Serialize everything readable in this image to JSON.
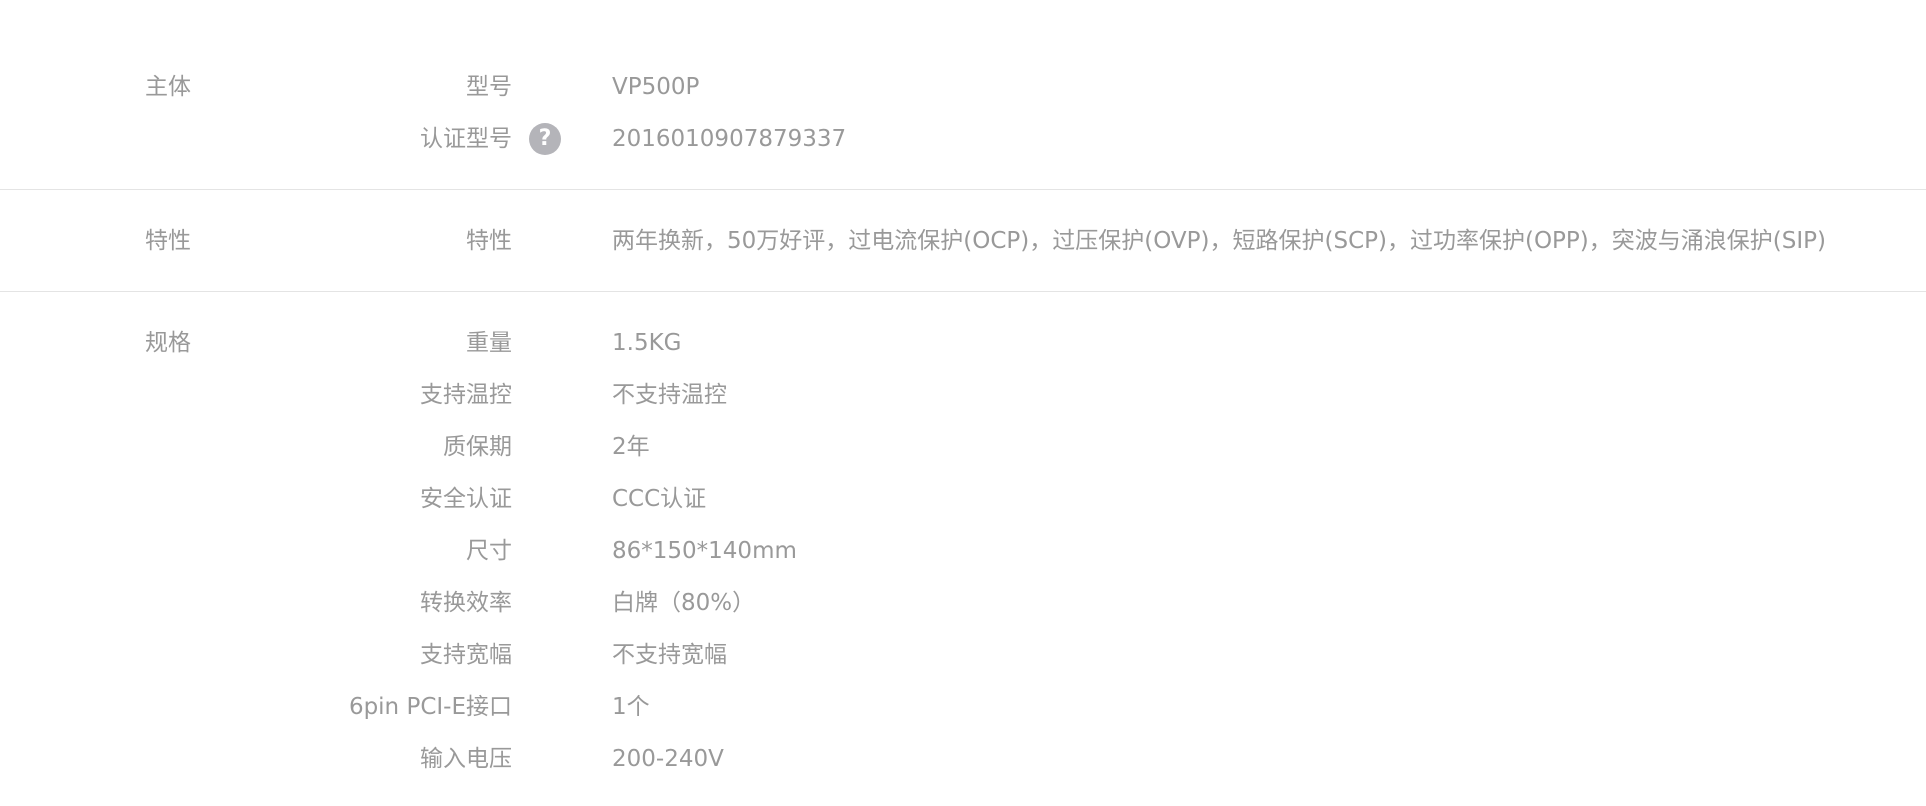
{
  "groups": [
    {
      "title": "主体",
      "rows": [
        {
          "label": "型号",
          "value": "VP500P"
        },
        {
          "label": "认证型号",
          "value": "2016010907879337",
          "help_icon": "question-circle-icon",
          "help_glyph": "?"
        }
      ]
    },
    {
      "title": "特性",
      "rows": [
        {
          "label": "特性",
          "value": "两年换新，50万好评，过电流保护(OCP)，过压保护(OVP)，短路保护(SCP)，过功率保护(OPP)，突波与涌浪保护(SIP)"
        }
      ]
    },
    {
      "title": "规格",
      "rows": [
        {
          "label": "重量",
          "value": "1.5KG"
        },
        {
          "label": "支持温控",
          "value": "不支持温控"
        },
        {
          "label": "质保期",
          "value": "2年"
        },
        {
          "label": "安全认证",
          "value": "CCC认证"
        },
        {
          "label": "尺寸",
          "value": "86*150*140mm"
        },
        {
          "label": "转换效率",
          "value": "白牌（80%）"
        },
        {
          "label": "支持宽幅",
          "value": "不支持宽幅"
        },
        {
          "label": "6pin PCI-E接口",
          "value": "1个"
        },
        {
          "label": "输入电压",
          "value": "200-240V"
        }
      ]
    }
  ],
  "colors": {
    "text": "#999999",
    "divider": "#e4e4e4",
    "icon_bg": "#b4b4b9"
  }
}
